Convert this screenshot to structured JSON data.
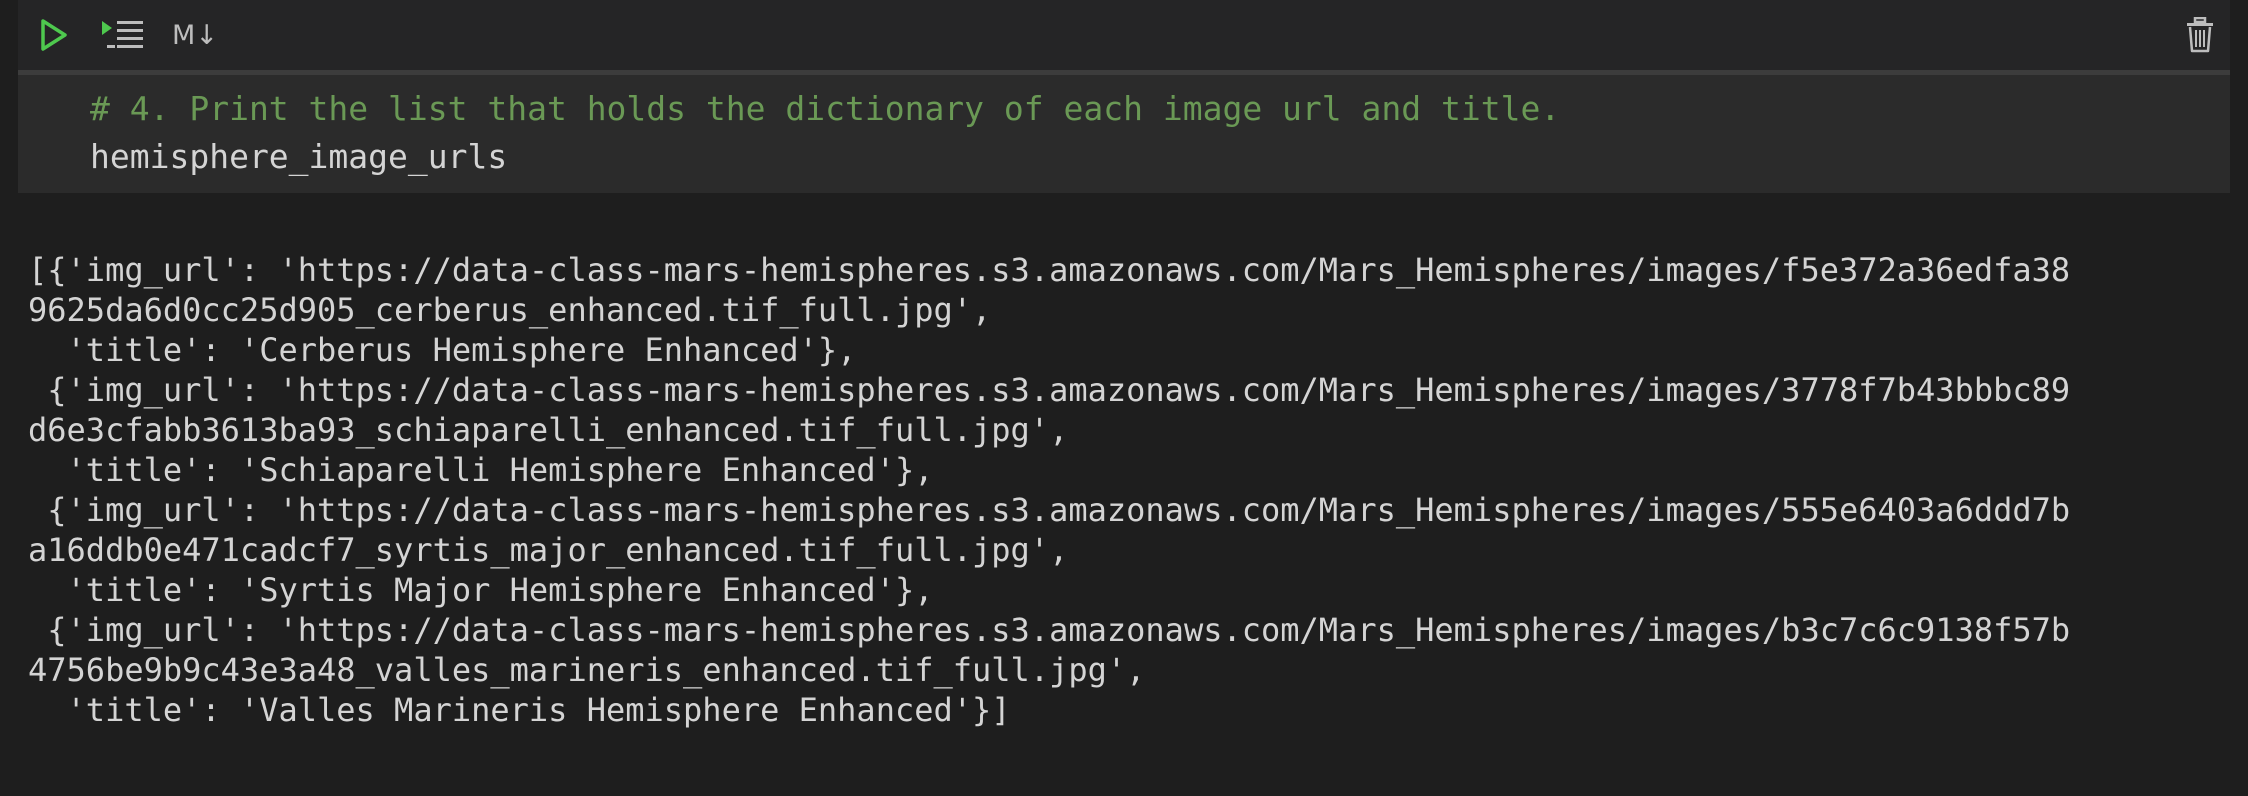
{
  "toolbar": {
    "run_icon": "play-icon",
    "run_below_icon": "run-below-icon",
    "markdown_label": "M↓",
    "delete_icon": "trash-icon"
  },
  "cell": {
    "code_lines": [
      "# 4. Print the list that holds the dictionary of each image url and title.",
      "hemisphere_image_urls"
    ]
  },
  "output": {
    "lines": [
      "[{'img_url': 'https://data-class-mars-hemispheres.s3.amazonaws.com/Mars_Hemispheres/images/f5e372a36edfa38",
      "9625da6d0cc25d905_cerberus_enhanced.tif_full.jpg',",
      "  'title': 'Cerberus Hemisphere Enhanced'},",
      " {'img_url': 'https://data-class-mars-hemispheres.s3.amazonaws.com/Mars_Hemispheres/images/3778f7b43bbbc89",
      "d6e3cfabb3613ba93_schiaparelli_enhanced.tif_full.jpg',",
      "  'title': 'Schiaparelli Hemisphere Enhanced'},",
      " {'img_url': 'https://data-class-mars-hemispheres.s3.amazonaws.com/Mars_Hemispheres/images/555e6403a6ddd7b",
      "a16ddb0e471cadcf7_syrtis_major_enhanced.tif_full.jpg',",
      "  'title': 'Syrtis Major Hemisphere Enhanced'},",
      " {'img_url': 'https://data-class-mars-hemispheres.s3.amazonaws.com/Mars_Hemispheres/images/b3c7c6c9138f57b",
      "4756be9b9c43e3a48_valles_marineris_enhanced.tif_full.jpg',",
      "  'title': 'Valles Marineris Hemisphere Enhanced'}]"
    ]
  },
  "colors": {
    "background": "#1e1e1e",
    "cell_background": "#2b2b2b",
    "run_green": "#4ec94e",
    "comment_green": "#6a9955",
    "text": "#d4d4d4"
  }
}
